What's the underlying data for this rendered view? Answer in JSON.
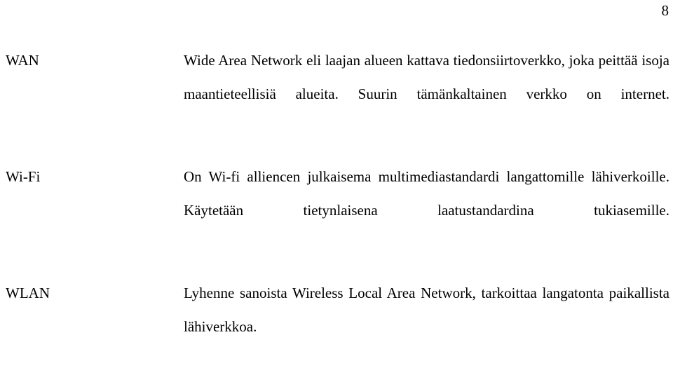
{
  "document": {
    "page_number": "8",
    "background_color": "#ffffff",
    "text_color": "#000000",
    "entries": [
      {
        "term": "WAN",
        "definition": "Wide Area Network eli laajan alueen kattava tiedonsiirtoverkko, joka peittää isoja maantieteellisiä alueita. Suurin tämänkaltainen verkko on internet.",
        "lines": [
          "Wide Area Network eli laajan alueen kattava",
          "tiedonsiirtoverkko, joka peittää isoja maantieteellisiä",
          "alueita. Suurin tämänkaltainen verkko on internet."
        ]
      },
      {
        "term": "Wi-Fi",
        "definition": "On Wi-fi alliencen julkaisema multimediastandardi langattomille lähiverkoille. Käytetään tietynlaisena laatustandardina tukiasemille.",
        "lines": [
          "On Wi-fi alliencen julkaisema multimediastandardi",
          "langattomille lähiverkoille. Käytetään tietynlaisena",
          "laatustandardina tukiasemille."
        ]
      },
      {
        "term": "WLAN",
        "definition": "Lyhenne sanoista Wireless Local Area Network, tarkoittaa langatonta paikallista lähiverkkoa.",
        "lines": [
          "Lyhenne sanoista Wireless Local Area Network, tarkoittaa",
          "langatonta paikallista lähiverkkoa."
        ]
      }
    ]
  }
}
